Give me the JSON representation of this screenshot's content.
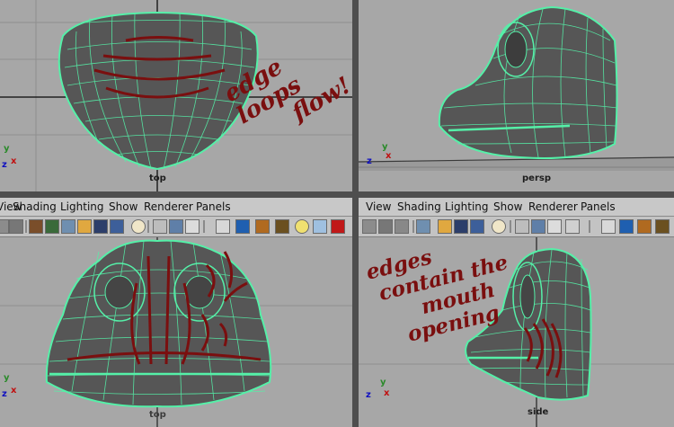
{
  "viewports": {
    "top": {
      "camera_label": "top"
    },
    "persp": {
      "camera_label": "persp"
    },
    "front": {
      "camera_label": "top"
    },
    "side": {
      "camera_label": "side"
    }
  },
  "menu": [
    "View",
    "Shading",
    "Lighting",
    "Show",
    "Renderer",
    "Panels"
  ],
  "axis": {
    "x": "x",
    "y": "y",
    "z": "z"
  },
  "annotations": {
    "top_right": [
      "edge loops",
      "flow!"
    ],
    "side": [
      "edges",
      "contain the",
      "mouth",
      "opening"
    ]
  },
  "colors": {
    "viewport_bg": "#a7a7a7",
    "wire": "#55f0a8",
    "mesh": "#565656",
    "annotation": "#7a0f0f",
    "menubar": "#c8c8c8"
  },
  "toolbar_icons": [
    "camera-select-icon",
    "camera-icon",
    "camera-attributes-icon",
    "bookmark-icon",
    "image-plane-icon",
    "grid-icon",
    "film-gate-icon",
    "resolution-gate-icon",
    "safe-action-icon",
    "field-chart-icon",
    "wireframe-icon",
    "smooth-shade-icon",
    "textured-icon",
    "lighting-icon",
    "isolate-select-icon",
    "xray-icon",
    "default-material-icon",
    "bounding-box-icon",
    "render-icon",
    "ipr-icon",
    "snapshot-icon",
    "color-swatch-icon"
  ]
}
